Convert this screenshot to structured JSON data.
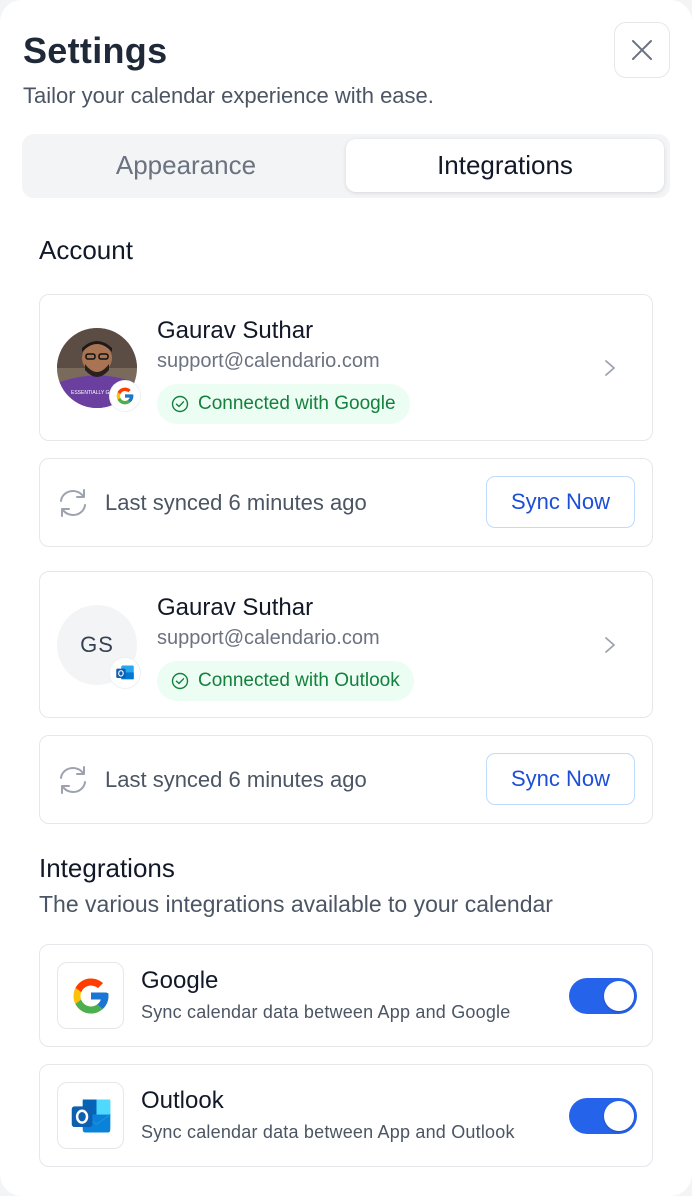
{
  "header": {
    "title": "Settings",
    "subtitle": "Tailor your calendar experience with ease.",
    "close_icon": "close-icon"
  },
  "tabs": [
    {
      "label": "Appearance",
      "active": false
    },
    {
      "label": "Integrations",
      "active": true
    }
  ],
  "account_section": {
    "title": "Account",
    "accounts": [
      {
        "name": "Gaurav Suthar",
        "email": "support@calendario.com",
        "status": "Connected with Google",
        "provider_icon": "google-icon",
        "avatar_type": "photo",
        "sync_text": "Last synced 6 minutes ago",
        "sync_button": "Sync Now"
      },
      {
        "name": "Gaurav Suthar",
        "email": "support@calendario.com",
        "status": "Connected with Outlook",
        "provider_icon": "outlook-icon",
        "avatar_initials": "GS",
        "sync_text": "Last synced 6 minutes ago",
        "sync_button": "Sync Now"
      }
    ]
  },
  "integrations_section": {
    "title": "Integrations",
    "subtitle": "The various integrations available to your calendar",
    "items": [
      {
        "name": "Google",
        "description": "Sync calendar data between App and Google",
        "enabled": true,
        "icon": "google-icon"
      },
      {
        "name": "Outlook",
        "description": "Sync calendar data between App and Outlook",
        "enabled": true,
        "icon": "outlook-icon"
      }
    ]
  },
  "colors": {
    "accent": "#2563eb",
    "success_text": "#15803d",
    "success_bg": "#ecfdf3",
    "border": "#e5e7eb"
  }
}
